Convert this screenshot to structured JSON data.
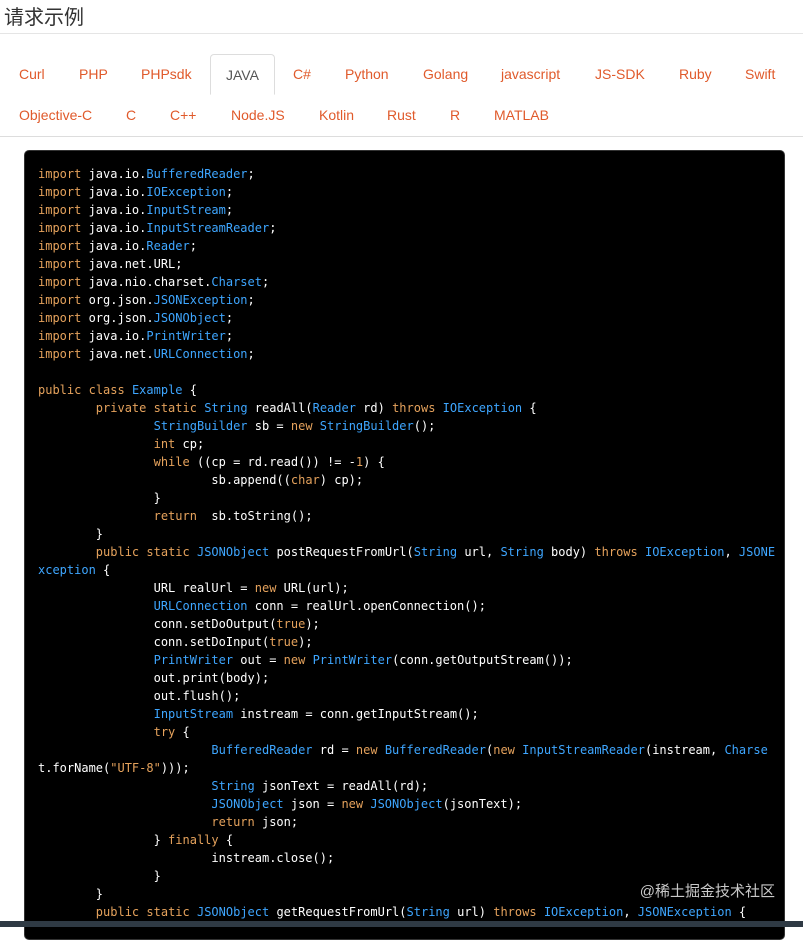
{
  "section": {
    "title": "请求示例"
  },
  "tabs": {
    "row1": [
      "Curl",
      "PHP",
      "PHPsdk",
      "JAVA",
      "C#",
      "Python",
      "Golang",
      "javascript",
      "JS-SDK",
      "Ruby",
      "Swift"
    ],
    "row2": [
      "Objective-C",
      "C",
      "C++",
      "Node.JS",
      "Kotlin",
      "Rust",
      "R",
      "MATLAB"
    ],
    "active": "JAVA"
  },
  "code": {
    "language": "JAVA",
    "lines": [
      "import java.io.BufferedReader;",
      "import java.io.IOException;",
      "import java.io.InputStream;",
      "import java.io.InputStreamReader;",
      "import java.io.Reader;",
      "import java.net.URL;",
      "import java.nio.charset.Charset;",
      "import org.json.JSONException;",
      "import org.json.JSONObject;",
      "import java.io.PrintWriter;",
      "import java.net.URLConnection;",
      "",
      "public class Example {",
      "        private static String readAll(Reader rd) throws IOException {",
      "                StringBuilder sb = new StringBuilder();",
      "                int cp;",
      "                while ((cp = rd.read()) != -1) {",
      "                        sb.append((char) cp);",
      "                }",
      "                return  sb.toString();",
      "        }",
      "        public static JSONObject postRequestFromUrl(String url, String body) throws IOException, JSONE",
      "xception {",
      "                URL realUrl = new URL(url);",
      "                URLConnection conn = realUrl.openConnection();",
      "                conn.setDoOutput(true);",
      "                conn.setDoInput(true);",
      "                PrintWriter out = new PrintWriter(conn.getOutputStream());",
      "                out.print(body);",
      "                out.flush();",
      "                InputStream instream = conn.getInputStream();",
      "                try {",
      "                        BufferedReader rd = new BufferedReader(new InputStreamReader(instream, Charse",
      "t.forName(\"UTF-8\")));",
      "                        String jsonText = readAll(rd);",
      "                        JSONObject json = new JSONObject(jsonText);",
      "                        return json;",
      "                } finally {",
      "                        instream.close();",
      "                }",
      "        }",
      "        public static JSONObject getRequestFromUrl(String url) throws IOException, JSONException {"
    ]
  },
  "watermark": "@稀土掘金技术社区",
  "colors": {
    "tab_link": "#e05a2b",
    "code_bg": "#000000",
    "keyword": "#e5a25c",
    "type": "#3ea6ff"
  }
}
